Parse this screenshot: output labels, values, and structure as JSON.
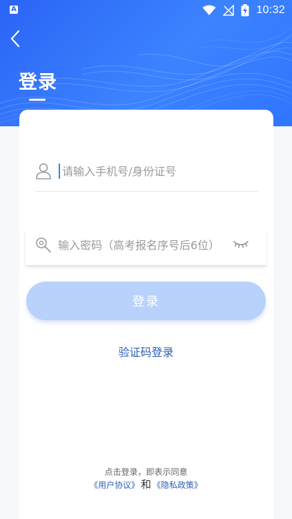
{
  "status": {
    "app_badge": "A",
    "time": "10:32"
  },
  "header": {
    "title": "登录"
  },
  "form": {
    "account_placeholder": "请输入手机号/身份证号",
    "password_placeholder": "输入密码（高考报名序号后6位）",
    "login_button": "登录",
    "alt_login": "验证码登录"
  },
  "footer": {
    "agree_text": "点击登录，即表示同意",
    "user_agreement": "《用户协议》",
    "and": "和",
    "privacy_policy": "《隐私政策》"
  },
  "colors": {
    "accent": "#2a64f5",
    "button_disabled": "#b8d2fc",
    "link": "#2c5fb8"
  }
}
